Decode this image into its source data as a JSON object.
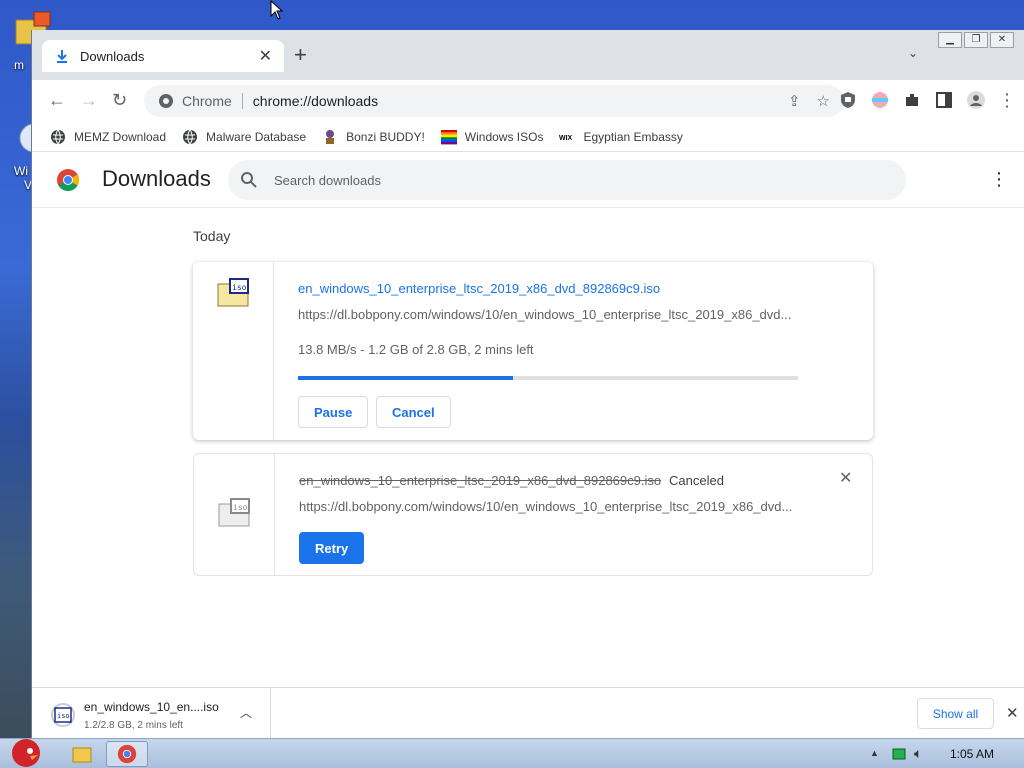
{
  "desktop": {
    "labels": [
      "m",
      "Wi",
      "V"
    ]
  },
  "browser": {
    "tab": {
      "title": "Downloads"
    },
    "toolbar": {
      "site_label": "Chrome",
      "url": "chrome://downloads"
    },
    "bookmarks": [
      {
        "label": "MEMZ Download",
        "icon": "globe-icon"
      },
      {
        "label": "Malware Database",
        "icon": "globe-icon"
      },
      {
        "label": "Bonzi BUDDY!",
        "icon": "bonzi-icon"
      },
      {
        "label": "Windows ISOs",
        "icon": "rainbow-flag-icon"
      },
      {
        "label": "Egyptian Embassy",
        "icon": "wix-icon"
      }
    ]
  },
  "page": {
    "title": "Downloads",
    "search_placeholder": "Search downloads",
    "section_date": "Today",
    "downloads": [
      {
        "filename": "en_windows_10_enterprise_ltsc_2019_x86_dvd_892869c9.iso",
        "url": "https://dl.bobpony.com/windows/10/en_windows_10_enterprise_ltsc_2019_x86_dvd...",
        "status": "13.8 MB/s - 1.2 GB of 2.8 GB, 2 mins left",
        "progress": 0.43,
        "buttons": [
          "Pause",
          "Cancel"
        ]
      },
      {
        "filename": "en_windows_10_enterprise_ltsc_2019_x86_dvd_892869c9.iso",
        "url": "https://dl.bobpony.com/windows/10/en_windows_10_enterprise_ltsc_2019_x86_dvd...",
        "status": "Canceled",
        "buttons": [
          "Retry"
        ]
      }
    ]
  },
  "shelf": {
    "name": "en_windows_10_en....iso",
    "status": "1.2/2.8 GB, 2 mins left",
    "show_all": "Show all"
  },
  "taskbar": {
    "clock": "1:05 AM"
  },
  "colors": {
    "accent": "#1a73e8",
    "progress_fill": "#1a73e8"
  }
}
